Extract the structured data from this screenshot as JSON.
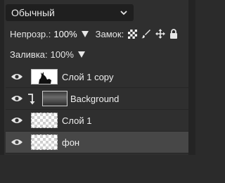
{
  "blend_mode": {
    "selected": "Обычный"
  },
  "opacity": {
    "label": "Непрозр.:",
    "value": "100%"
  },
  "lock": {
    "label": "Замок:"
  },
  "fill": {
    "label": "Заливка:",
    "value": "100%"
  },
  "layers": [
    {
      "name": "Слой 1 copy"
    },
    {
      "name": "Background"
    },
    {
      "name": "Слой 1"
    },
    {
      "name": "фон"
    }
  ],
  "colors": {
    "panel": "#2f2f2f",
    "active_row": "#474747",
    "select_bg": "#1f1f1f"
  }
}
